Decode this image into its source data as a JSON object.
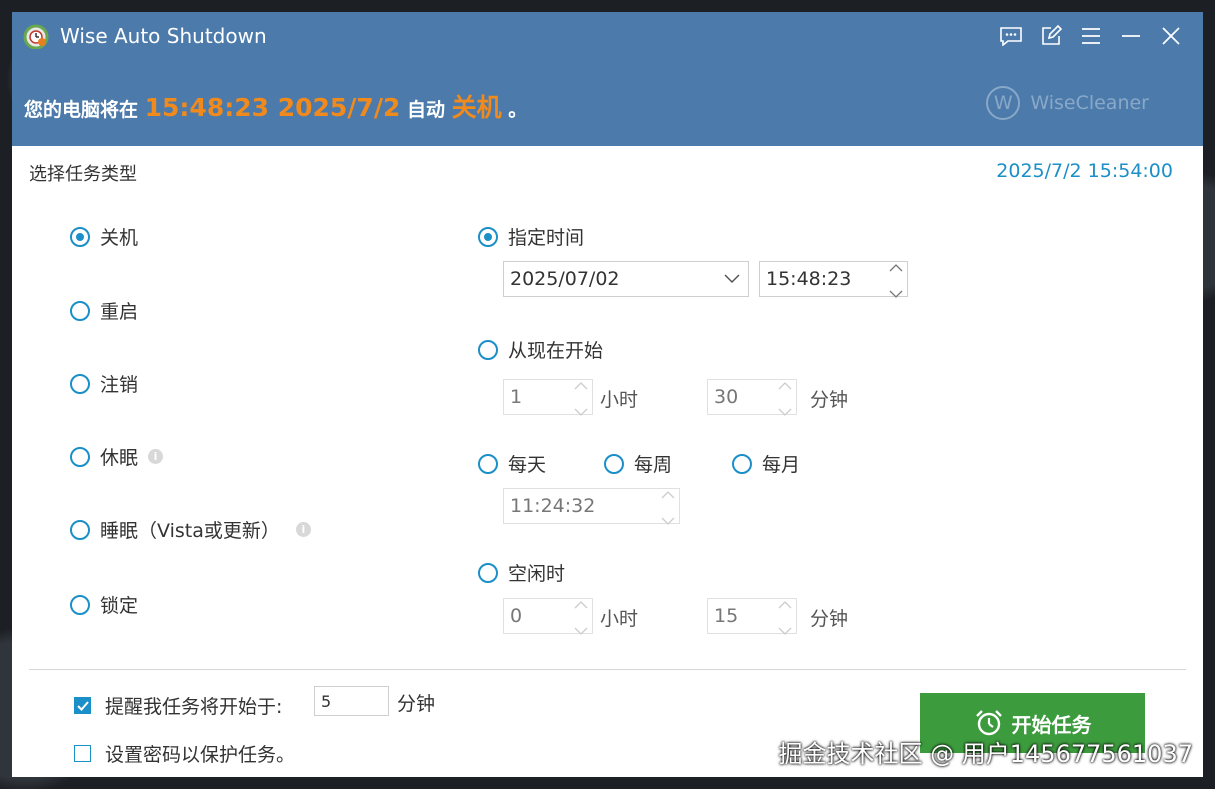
{
  "window": {
    "title": "Wise Auto Shutdown"
  },
  "banner": {
    "prefix": "您的电脑将在",
    "time": "15:48:23 2025/7/2",
    "middle": "自动",
    "action": "关机",
    "suffix": "。",
    "brand": "WiseCleaner",
    "brand_logo_letter": "W"
  },
  "task_section": {
    "title": "选择任务类型",
    "current_datetime": "2025/7/2 15:54:00"
  },
  "task_types": [
    {
      "label": "关机",
      "selected": true
    },
    {
      "label": "重启",
      "selected": false
    },
    {
      "label": "注销",
      "selected": false
    },
    {
      "label": "休眠",
      "selected": false,
      "info": true
    },
    {
      "label": "睡眠（Vista或更新）",
      "selected": false,
      "info": true
    },
    {
      "label": "锁定",
      "selected": false
    }
  ],
  "schedule": {
    "specified_time": {
      "label": "指定时间",
      "selected": true,
      "date": "2025/07/02",
      "time": "15:48:23"
    },
    "from_now": {
      "label": "从现在开始",
      "selected": false,
      "hours": "1",
      "hours_unit": "小时",
      "minutes": "30",
      "minutes_unit": "分钟"
    },
    "recurring": {
      "daily": "每天",
      "weekly": "每周",
      "monthly": "每月",
      "time": "11:24:32"
    },
    "idle": {
      "label": "空闲时",
      "selected": false,
      "hours": "0",
      "hours_unit": "小时",
      "minutes": "15",
      "minutes_unit": "分钟"
    }
  },
  "footer": {
    "remind_label": "提醒我任务将开始于:",
    "remind_value": "5",
    "remind_unit": "分钟",
    "remind_checked": true,
    "password_label": "设置密码以保护任务。",
    "password_checked": false,
    "start_button": "开始任务"
  },
  "watermark": "掘金技术社区 @ 用户145677561037",
  "colors": {
    "titlebar": "#4b7aab",
    "accent": "#1a8fc8",
    "highlight": "#f08a1c",
    "start_button": "#3c9b3d"
  },
  "icons": {
    "title_controls": [
      "feedback-icon",
      "edit-icon",
      "menu-icon",
      "minimize-icon",
      "close-icon"
    ]
  }
}
